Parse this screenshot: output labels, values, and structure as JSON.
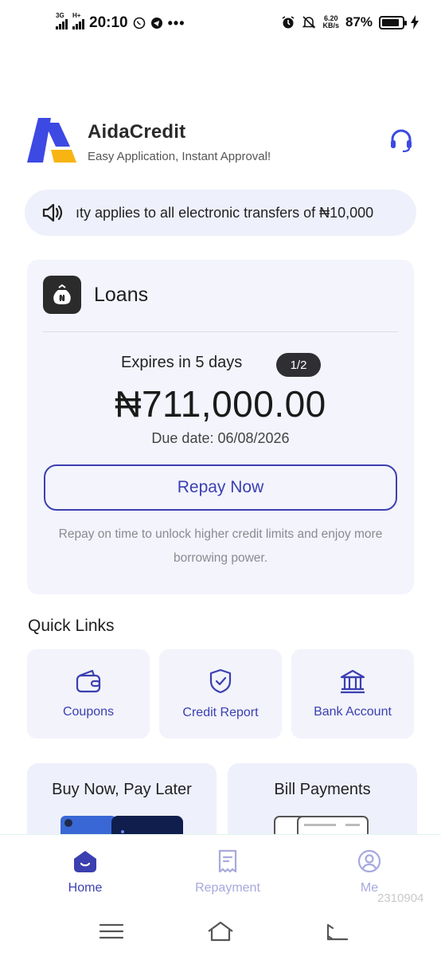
{
  "status_bar": {
    "network_1": "3G",
    "network_2": "H+",
    "time": "20:10",
    "net_speed_value": "6.20",
    "net_speed_unit": "KB/s",
    "battery": "87%",
    "battery_level": 0.87
  },
  "header": {
    "app_name": "AidaCredit",
    "tagline": "Easy Application, Instant Approval!",
    "logo_colors": {
      "blue": "#3d49e3",
      "yellow": "#f7b413"
    }
  },
  "announcement": {
    "text": "ıty applies to all electronic transfers of ₦10,000"
  },
  "loan_card": {
    "title": "Loans",
    "expires": "Expires in 5 days",
    "page_indicator": "1/2",
    "amount": "₦711,000.00",
    "due_label": "Due date:",
    "due_date": "06/08/2026",
    "repay_button": "Repay Now",
    "hint": "Repay on time to unlock higher credit limits and enjoy more borrowing power."
  },
  "quick_links": {
    "title": "Quick Links",
    "items": [
      {
        "label": "Coupons",
        "icon": "wallet-icon"
      },
      {
        "label": "Credit Report",
        "icon": "shield-check-icon"
      },
      {
        "label": "Bank Account",
        "icon": "bank-icon"
      }
    ]
  },
  "promos": [
    {
      "title": "Buy Now, Pay Later"
    },
    {
      "title": "Bill Payments"
    }
  ],
  "bottom_nav": {
    "items": [
      {
        "label": "Home",
        "icon": "home-icon",
        "active": true
      },
      {
        "label": "Repayment",
        "icon": "receipt-icon",
        "active": false
      },
      {
        "label": "Me",
        "icon": "user-icon",
        "active": false
      }
    ]
  },
  "watermark": "2310904",
  "colors": {
    "accent": "#3b3fb0",
    "card_bg": "#f3f4fc",
    "inactive_nav": "#a7a9de"
  }
}
